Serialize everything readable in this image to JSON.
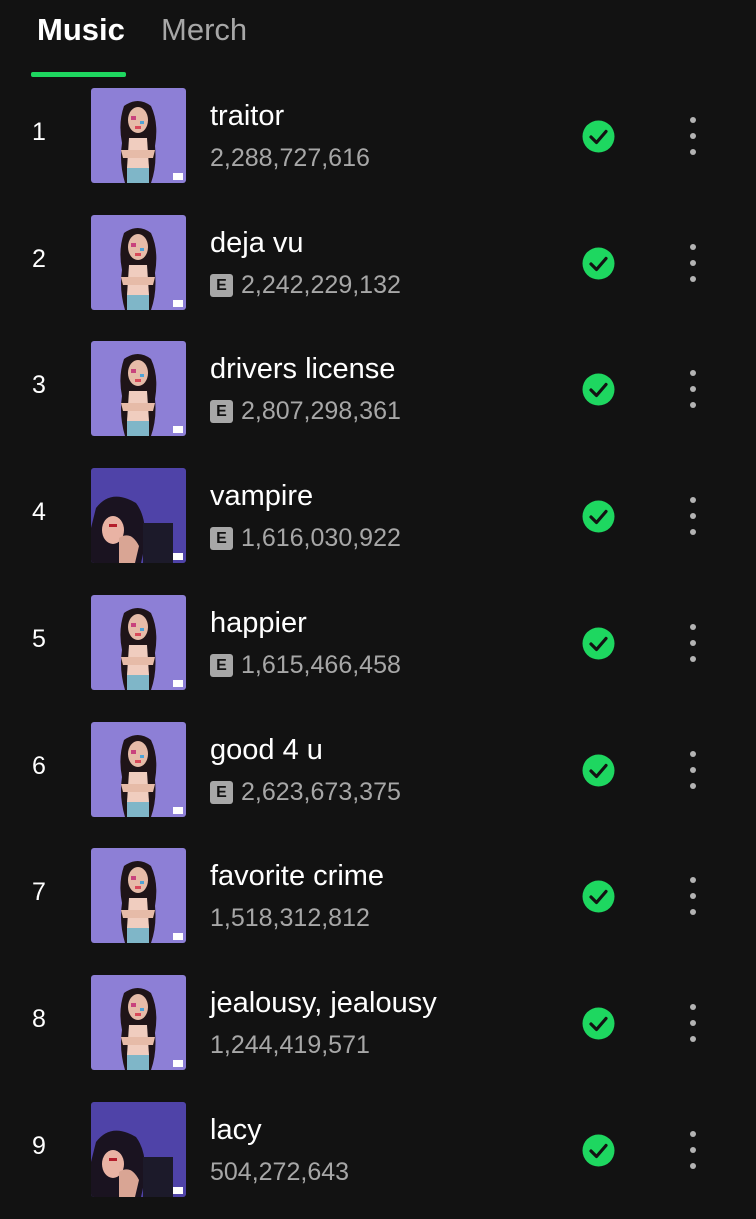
{
  "tabs": [
    {
      "label": "Music",
      "active": true
    },
    {
      "label": "Merch",
      "active": false
    }
  ],
  "colors": {
    "accent": "#1ed760",
    "background": "#121212",
    "secondary_text": "#a7a7a7",
    "cover_sour": "#8d7fd6",
    "cover_guts": "#5a4fb8"
  },
  "explicit_badge": "E",
  "tracks": [
    {
      "rank": "1",
      "title": "traitor",
      "plays": "2,288,727,616",
      "explicit": false,
      "cover": "sour",
      "saved": true
    },
    {
      "rank": "2",
      "title": "deja vu",
      "plays": "2,242,229,132",
      "explicit": true,
      "cover": "sour",
      "saved": true
    },
    {
      "rank": "3",
      "title": "drivers license",
      "plays": "2,807,298,361",
      "explicit": true,
      "cover": "sour",
      "saved": true
    },
    {
      "rank": "4",
      "title": "vampire",
      "plays": "1,616,030,922",
      "explicit": true,
      "cover": "guts",
      "saved": true
    },
    {
      "rank": "5",
      "title": "happier",
      "plays": "1,615,466,458",
      "explicit": true,
      "cover": "sour",
      "saved": true
    },
    {
      "rank": "6",
      "title": "good 4 u",
      "plays": "2,623,673,375",
      "explicit": true,
      "cover": "sour",
      "saved": true
    },
    {
      "rank": "7",
      "title": "favorite crime",
      "plays": "1,518,312,812",
      "explicit": false,
      "cover": "sour",
      "saved": true
    },
    {
      "rank": "8",
      "title": "jealousy, jealousy",
      "plays": "1,244,419,571",
      "explicit": false,
      "cover": "sour",
      "saved": true
    },
    {
      "rank": "9",
      "title": "lacy",
      "plays": "504,272,643",
      "explicit": false,
      "cover": "guts",
      "saved": true
    }
  ],
  "icons": {
    "saved": "check-circle-icon",
    "more": "more-options-icon"
  }
}
